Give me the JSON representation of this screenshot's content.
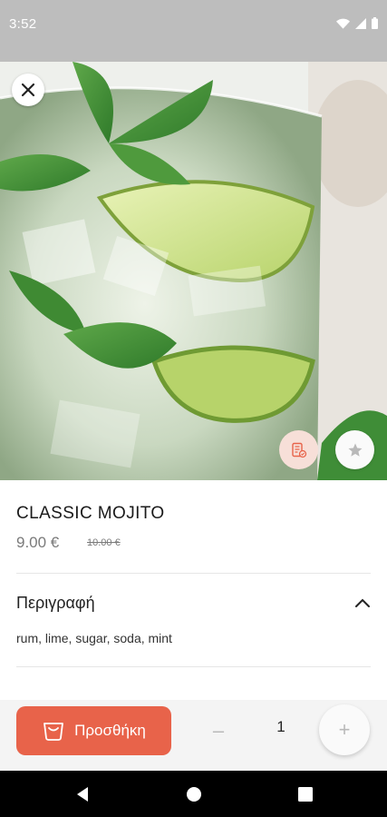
{
  "status_bar": {
    "time": "3:52",
    "icons": [
      "wifi-icon",
      "signal-icon",
      "battery-icon"
    ]
  },
  "hero": {
    "image": "mojito-glass-photo",
    "buttons": {
      "close": "close-icon",
      "ingredients": "ingredients-list-icon",
      "favorite": "star-icon"
    }
  },
  "product": {
    "name": "CLASSIC MOJITO",
    "price": "9.00 €",
    "old_price": "10.00 €"
  },
  "description": {
    "title": "Περιγραφή",
    "text": "rum, lime, sugar, soda, mint",
    "expanded": true
  },
  "cart_bar": {
    "add_label": "Προσθήκη",
    "minus": "–",
    "quantity": "1",
    "plus": "+"
  },
  "colors": {
    "accent": "#e8634a",
    "accent_light": "#f7dfd8",
    "status_bar": "#bdbdbd",
    "nav_bar": "#000000"
  },
  "nav_bar": {
    "buttons": [
      "back-icon",
      "home-icon",
      "recents-icon"
    ]
  }
}
